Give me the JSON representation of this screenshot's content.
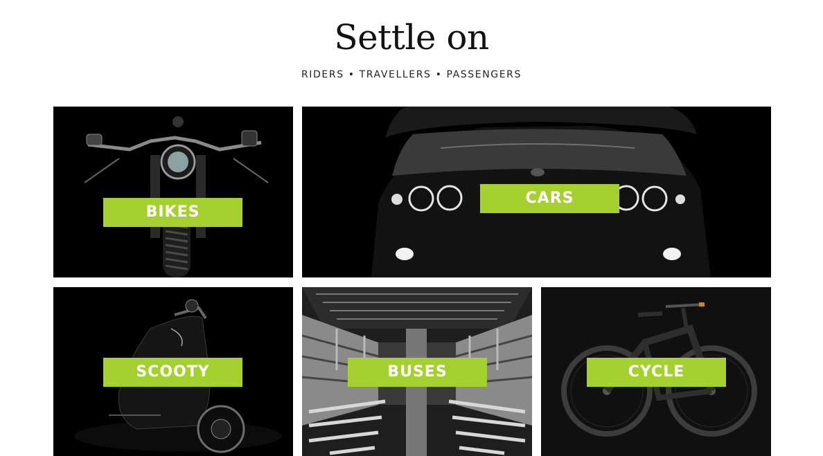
{
  "header": {
    "title": "Settle on",
    "subtitle": "RIDERS • TRAVELLERS • PASSENGERS"
  },
  "theme": {
    "accent": "#a6d02f",
    "tile_background": "#000000"
  },
  "categories": [
    {
      "label": "BIKES",
      "image": "motorcycle-front-image"
    },
    {
      "label": "CARS",
      "image": "car-headlights-image"
    },
    {
      "label": "SCOOTY",
      "image": "scooter-image"
    },
    {
      "label": "BUSES",
      "image": "bus-interior-image"
    },
    {
      "label": "CYCLE",
      "image": "bicycle-image"
    }
  ]
}
